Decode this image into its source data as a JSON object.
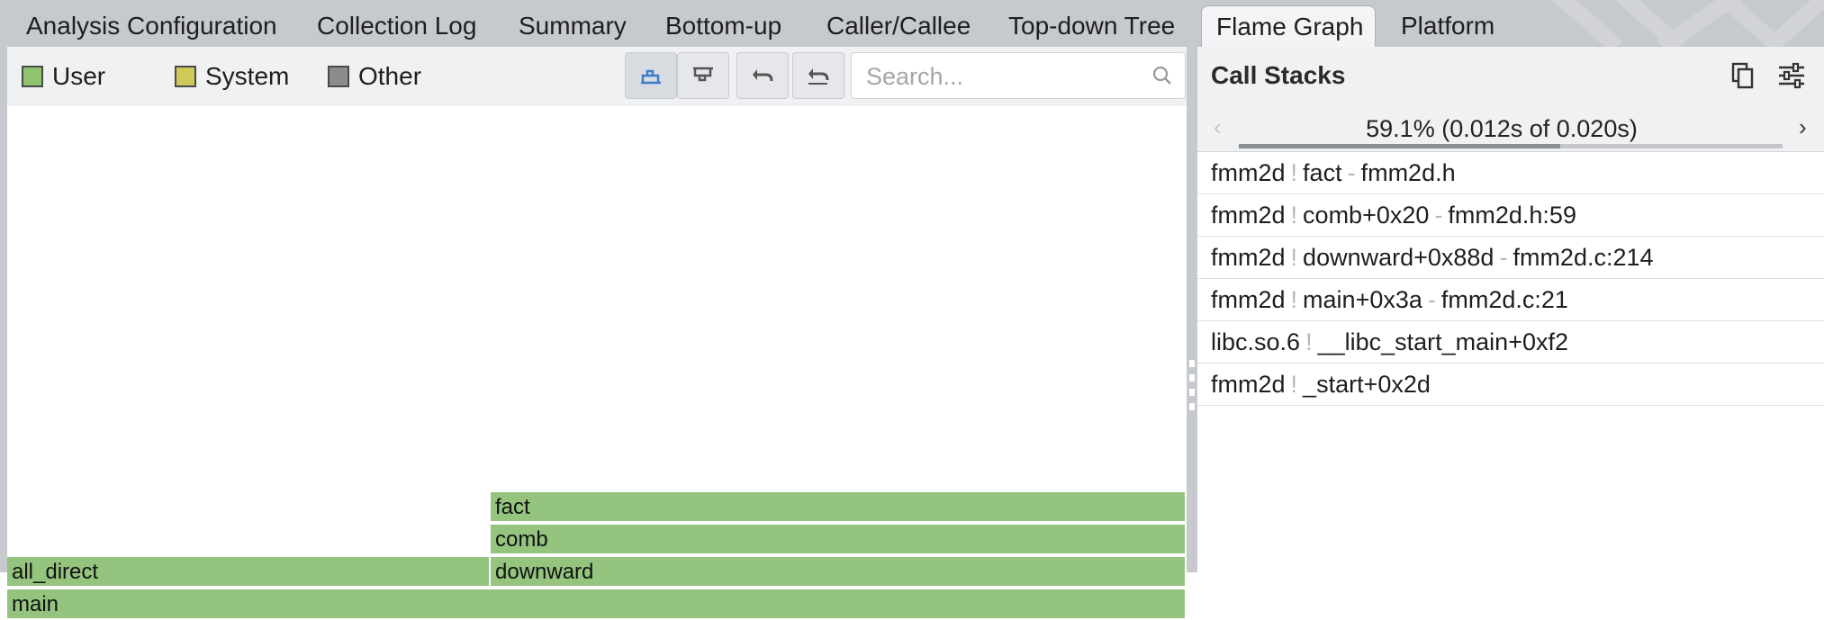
{
  "tabs": [
    {
      "label": "Analysis Configuration",
      "active": false
    },
    {
      "label": "Collection Log",
      "active": false
    },
    {
      "label": "Summary",
      "active": false
    },
    {
      "label": "Bottom-up",
      "active": false
    },
    {
      "label": "Caller/Callee",
      "active": false
    },
    {
      "label": "Top-down Tree",
      "active": false
    },
    {
      "label": "Flame Graph",
      "active": true
    },
    {
      "label": "Platform",
      "active": false
    }
  ],
  "legend": [
    {
      "label": "User",
      "color": "#8fc46f"
    },
    {
      "label": "System",
      "color": "#cfc95a"
    },
    {
      "label": "Other",
      "color": "#8c8c8c"
    }
  ],
  "toolbar": {
    "buttons": [
      "flame-chart-icon",
      "icicle-chart-icon",
      "undo-icon",
      "undo-all-icon"
    ],
    "search_placeholder": "Search..."
  },
  "flame_graph": {
    "frames": [
      {
        "label": "fact"
      },
      {
        "label": "comb"
      },
      {
        "label": "all_direct"
      },
      {
        "label": "downward"
      },
      {
        "label": "main"
      }
    ],
    "color": "#94c47e"
  },
  "call_stacks": {
    "title": "Call Stacks",
    "navigator": "59.1% (0.012s of 0.020s)",
    "navigator_fraction": 0.591,
    "rows": [
      {
        "module": "fmm2d",
        "sep1": "!",
        "func": "fact",
        "sep2": "-",
        "source": "fmm2d.h"
      },
      {
        "module": "fmm2d",
        "sep1": "!",
        "func": "comb+0x20",
        "sep2": "-",
        "source": "fmm2d.h:59"
      },
      {
        "module": "fmm2d",
        "sep1": "!",
        "func": "downward+0x88d",
        "sep2": "-",
        "source": "fmm2d.c:214"
      },
      {
        "module": "fmm2d",
        "sep1": "!",
        "func": "main+0x3a",
        "sep2": "-",
        "source": "fmm2d.c:21"
      },
      {
        "module": "libc.so.6",
        "sep1": "!",
        "func": "__libc_start_main+0xf2",
        "sep2": "",
        "source": ""
      },
      {
        "module": "fmm2d",
        "sep1": "!",
        "func": "_start+0x2d",
        "sep2": "",
        "source": ""
      }
    ]
  }
}
